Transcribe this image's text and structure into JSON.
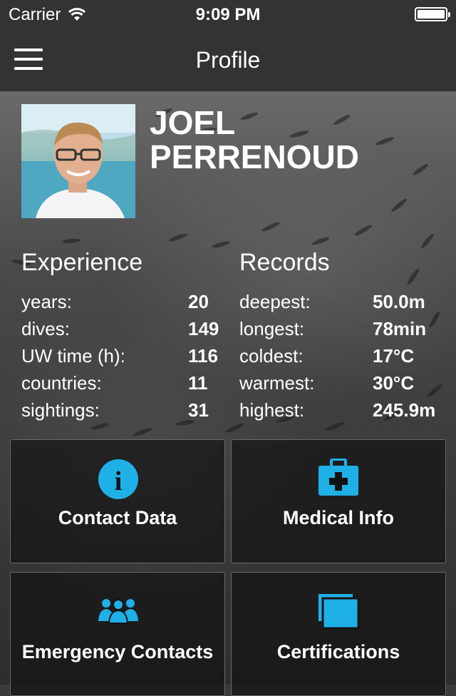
{
  "status": {
    "carrier": "Carrier",
    "time": "9:09 PM"
  },
  "nav": {
    "title": "Profile"
  },
  "profile": {
    "first_name": "JOEL",
    "last_name": "PERRENOUD"
  },
  "experience": {
    "title": "Experience",
    "rows": [
      {
        "label": "years:",
        "value": "20"
      },
      {
        "label": "dives:",
        "value": "149"
      },
      {
        "label": "UW time (h):",
        "value": "116"
      },
      {
        "label": "countries:",
        "value": "11"
      },
      {
        "label": "sightings:",
        "value": "31"
      }
    ]
  },
  "records": {
    "title": "Records",
    "rows": [
      {
        "label": "deepest:",
        "value": "50.0m"
      },
      {
        "label": "longest:",
        "value": "78min"
      },
      {
        "label": "coldest:",
        "value": "17°C"
      },
      {
        "label": "warmest:",
        "value": "30°C"
      },
      {
        "label": "highest:",
        "value": "245.9m"
      }
    ]
  },
  "tiles": {
    "contact": {
      "label": "Contact Data",
      "icon": "info-icon"
    },
    "medical": {
      "label": "Medical Info",
      "icon": "medical-kit-icon"
    },
    "emergency": {
      "label": "Emergency Contacts",
      "icon": "people-group-icon"
    },
    "certifications": {
      "label": "Certifications",
      "icon": "cards-stack-icon"
    }
  },
  "colors": {
    "accent": "#1fb0e8",
    "bar": "#333333"
  }
}
